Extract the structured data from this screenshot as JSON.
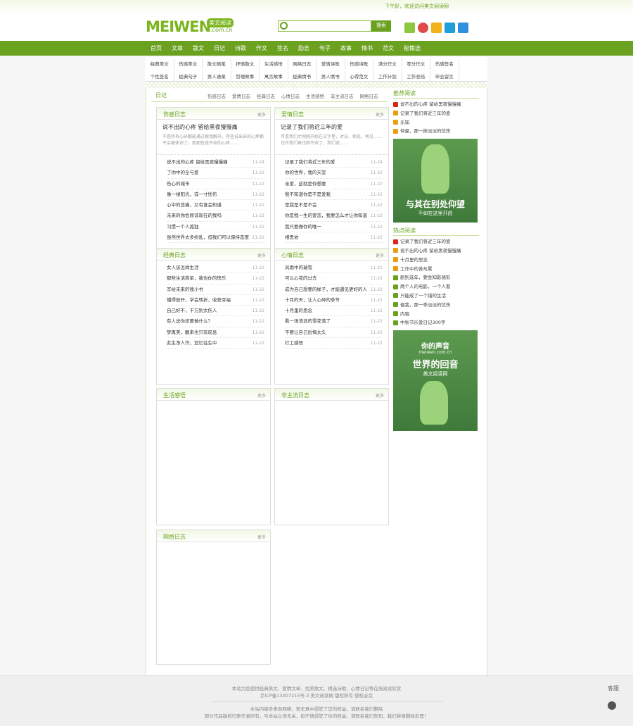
{
  "greeting": "下午好，欢迎访问美文阅读网",
  "logo": {
    "text": "MEIWEN",
    "cn": "美文阅读",
    "domain": ".com.cn"
  },
  "search": {
    "placeholder": "",
    "button": "搜索"
  },
  "nav": [
    "首页",
    "文章",
    "散文",
    "日记",
    "诗歌",
    "作文",
    "签名",
    "励志",
    "句子",
    "故事",
    "情书",
    "范文",
    "秘籍选"
  ],
  "subnav": {
    "row1": [
      "经典美文",
      "伤感美文",
      "散文随笔",
      "抒情散文",
      "生活感悟",
      "网络日志",
      "爱情诗歌",
      "伤感诗歌",
      "满分作文",
      "零分作文",
      "伤感签名"
    ],
    "row2": [
      "个性签名",
      "经典句子",
      "男人语录",
      "哲理故事",
      "寓言故事",
      "经典情书",
      "男人情书",
      "心得范文",
      "工作计划",
      "工作总结",
      "毕业留言"
    ]
  },
  "section": {
    "title": "日记",
    "tabs": [
      "伤感日志",
      "爱情日志",
      "经典日志",
      "心情日志",
      "生活感悟",
      "非主流日志",
      "网络日志"
    ]
  },
  "more": "更多",
  "boxes": [
    {
      "title": "伤感日志",
      "feat_title": "说不出的心疼 留给黑夜慢慢痛",
      "feat_desc": "不是所有心碎都能通过眼泪解开，有些说出来的心疼都不会被体谅了。而那些说不出的心疼……",
      "items": [
        {
          "t": "说不出的心疼 留给黑夜慢慢痛",
          "d": "11-24"
        },
        {
          "t": "了你中的全与爱",
          "d": "11-22"
        },
        {
          "t": "伤心的城市",
          "d": "11-22"
        },
        {
          "t": "像一缕阳光，或一寸忧伤",
          "d": "11-22"
        },
        {
          "t": "心中的悲痛，又有谁会知道",
          "d": "11-22"
        },
        {
          "t": "未来的你会原谅现在的我吗",
          "d": "11-22"
        },
        {
          "t": "习惯一个人孤独",
          "d": "11-22"
        },
        {
          "t": "虽然世界太多纷乱，但我们可以保持态度",
          "d": "11-22"
        }
      ]
    },
    {
      "title": "爱情日志",
      "feat_title": "记录了我们将近三年的爱",
      "feat_desc": "可是我们才刚刚开始在文字里，对日、相见、再见……也许我们再也回不去了，我们说……",
      "items": [
        {
          "t": "记录了我们将近三年的爱",
          "d": "11-24"
        },
        {
          "t": "你的世界，我的天堂",
          "d": "11-22"
        },
        {
          "t": "亲爱，这就是你想要",
          "d": "11-22"
        },
        {
          "t": "我不知道你是不是爱我",
          "d": "11-22"
        },
        {
          "t": "是我是不是不会",
          "d": "11-22"
        },
        {
          "t": "你是我一生的爱恋，我要怎么才让你知道",
          "d": "11-22"
        },
        {
          "t": "我只要做你的唯一",
          "d": "11-22"
        },
        {
          "t": "相思依",
          "d": "11-22"
        }
      ]
    },
    {
      "title": "经典日志",
      "items": [
        {
          "t": "女人该怎样生活",
          "d": "11-22"
        },
        {
          "t": "那些生活简单，我也你的快乐",
          "d": "11-22"
        },
        {
          "t": "写给未来的我小书",
          "d": "11-22"
        },
        {
          "t": "懂得放开，学会转折，收获幸福",
          "d": "11-22"
        },
        {
          "t": "自己好不，干万别太伤人",
          "d": "11-22"
        },
        {
          "t": "有人说你还要做什么？",
          "d": "11-22"
        },
        {
          "t": "梦再美，醒来也只有叹息",
          "d": "11-22"
        },
        {
          "t": "此生净人作，追忆往生中",
          "d": "11-22"
        }
      ]
    },
    {
      "title": "心情日志",
      "items": [
        {
          "t": "风雨中的瑞雪",
          "d": "11-22"
        },
        {
          "t": "可以心花的过去",
          "d": "11-22"
        },
        {
          "t": "成为自己想要的样子，才能遇见更好的人",
          "d": "11-22"
        },
        {
          "t": "十月的天，让人心碎的季节",
          "d": "11-22"
        },
        {
          "t": "十月里的思念",
          "d": "11-22"
        },
        {
          "t": "看一场流浪的雪花落了",
          "d": "11-22"
        },
        {
          "t": "不要让自己后悔太久",
          "d": "11-22"
        },
        {
          "t": "打工感悟",
          "d": "11-22"
        }
      ]
    },
    {
      "title": "生活感悟",
      "items": []
    },
    {
      "title": "非主流日志",
      "items": []
    },
    {
      "title": "网络日志",
      "items": []
    }
  ],
  "sidebar": {
    "rec_title": "推荐阅读",
    "rec": [
      "说不出的心疼 留给黑夜慢慢痛",
      "记录了我们将近三年的爱",
      "乐知",
      "仲夏，那一抹淡淡的忧伤"
    ],
    "banner1": {
      "big": "与其在别处仰望",
      "small": "不如在这里开启"
    },
    "hot_title": "热点阅读",
    "hot": [
      "记录了我们将近三年的爱",
      "说不出的心疼 留给黑夜慢慢痛",
      "十月里的思念",
      "工作中的苦与累",
      "剧别选年，要会知影随形",
      "两个人的电影，一个人看",
      "只能成了一个错的生活",
      "偏我，那一季淡淡的忧伤",
      "内容",
      "中秋节乐爱日记300字"
    ],
    "banner2": {
      "t1": "你的声音",
      "t2": "meiwen.com.cn",
      "t3": "世界的回音",
      "t4": "美文阅读网"
    },
    "colors": [
      "#d9281c",
      "#e6a00f",
      "#e6a00f",
      "#e6a00f",
      "#d9281c",
      "#e6a00f",
      "#e6a00f",
      "#e6a00f",
      "#6aa11e",
      "#6aa11e",
      "#6aa11e",
      "#6aa11e",
      "#6aa11e",
      "#6aa11e"
    ]
  },
  "footer": {
    "l1": "本站为您提供经典美文、爱情文章、优美散文、精选诗歌、心情日记等在线阅读欣赏",
    "l2": "京ICP备13007215号-3 美文阅读网 版权所有 侵权必究",
    "l3": "本站内容多来自网络，若无意中侵犯了您的权益，请联系我们删除",
    "l4": "部分作品版权归原作者所有，与本站立场无关，如不慎侵犯了你的权益，请联系我们告知，我们将做删除处理！"
  },
  "footer_right": "客服"
}
